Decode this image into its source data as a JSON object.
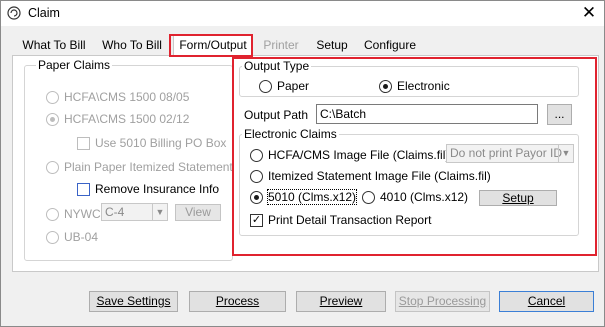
{
  "window": {
    "title": "Claim",
    "close_label": "✕"
  },
  "tabs": [
    {
      "label": "What To Bill",
      "state": "normal"
    },
    {
      "label": "Who To Bill",
      "state": "normal"
    },
    {
      "label": "Form/Output",
      "state": "active"
    },
    {
      "label": "Printer",
      "state": "disabled"
    },
    {
      "label": "Setup",
      "state": "normal"
    },
    {
      "label": "Configure",
      "state": "normal"
    }
  ],
  "paper_claims": {
    "label": "Paper Claims",
    "hcfa_0805": "HCFA\\CMS 1500 08/05",
    "hcfa_0212": "HCFA\\CMS 1500 02/12",
    "use_5010_po_box": "Use 5010 Billing PO Box",
    "plain_paper": "Plain Paper Itemized Statement",
    "remove_insurance": "Remove Insurance Info",
    "nywc": "NYWC",
    "nywc_select": "C-4",
    "view_button": "View",
    "ub04": "UB-04"
  },
  "output_type": {
    "label": "Output Type",
    "paper": "Paper",
    "electronic": "Electronic",
    "selected": "Electronic"
  },
  "output_path": {
    "label": "Output Path",
    "value": "C:\\Batch",
    "browse_label": "..."
  },
  "electronic_claims": {
    "label": "Electronic Claims",
    "hcfa_image": "HCFA/CMS Image File (Claims.fil)",
    "payor_select": "Do not print Payor ID",
    "itemized_image": "Itemized Statement Image File (Claims.fil)",
    "x12_5010": "5010 (Clms.x12)",
    "x12_4010": "4010 (Clms.x12)",
    "setup_button": "Setup",
    "print_detail": "Print Detail Transaction Report",
    "selected": "5010 (Clms.x12)",
    "print_detail_checked": true
  },
  "footer": {
    "save_settings": "Save Settings",
    "process": "Process",
    "preview": "Preview",
    "stop_processing": "Stop Processing",
    "cancel": "Cancel"
  },
  "colors": {
    "highlight": "#e0232f",
    "disabled": "#a0a0a0"
  }
}
